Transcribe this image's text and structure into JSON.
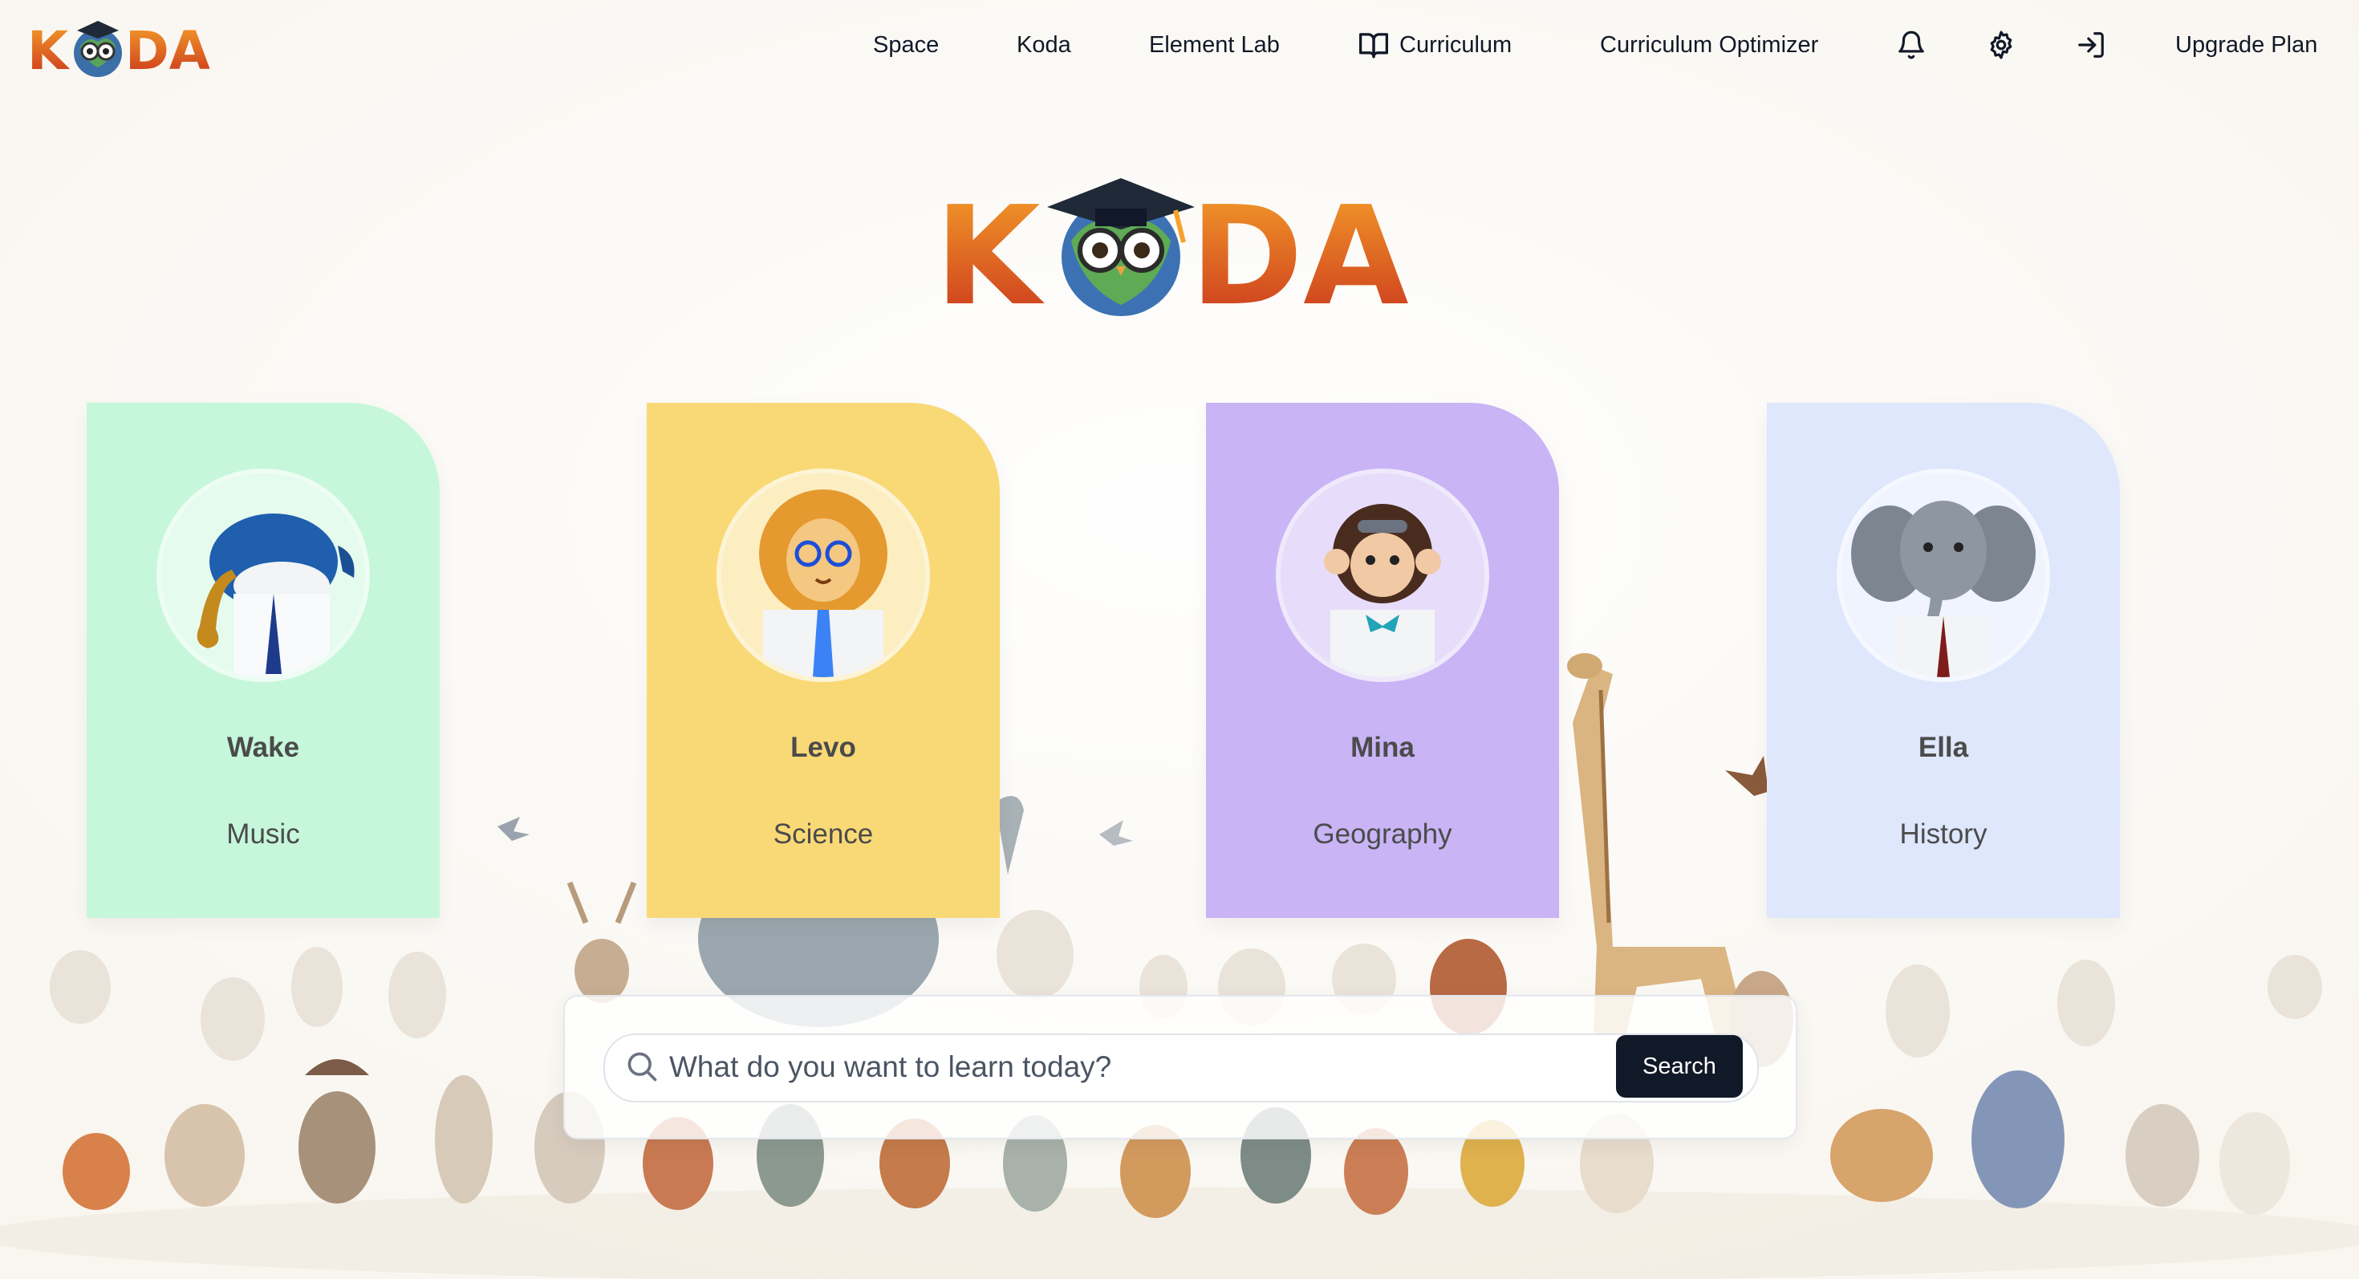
{
  "brand": {
    "name": "KODA"
  },
  "nav": {
    "items": [
      {
        "label": "Space"
      },
      {
        "label": "Koda"
      },
      {
        "label": "Element Lab"
      },
      {
        "label": "Curriculum",
        "icon": "book-open-icon"
      },
      {
        "label": "Curriculum Optimizer"
      }
    ],
    "icons": [
      "bell-icon",
      "gear-icon",
      "sign-in-icon"
    ],
    "upgrade_label": "Upgrade Plan"
  },
  "tutors": [
    {
      "name": "Wake",
      "subject": "Music",
      "color": "#c6f7da",
      "avatar": "whale-saxophone-avatar"
    },
    {
      "name": "Levo",
      "subject": "Science",
      "color": "#f9d976",
      "avatar": "lion-scientist-avatar"
    },
    {
      "name": "Mina",
      "subject": "Geography",
      "color": "#c9b4f5",
      "avatar": "monkey-explorer-avatar"
    },
    {
      "name": "Ella",
      "subject": "History",
      "color": "#dee7fc",
      "avatar": "elephant-professor-avatar"
    }
  ],
  "search": {
    "placeholder": "What do you want to learn today?",
    "button_label": "Search"
  },
  "colors": {
    "logo_gradient_top": "#f6a12a",
    "logo_gradient_bottom": "#c8311c",
    "search_button": "#111827",
    "background": "#fdfcf9"
  }
}
